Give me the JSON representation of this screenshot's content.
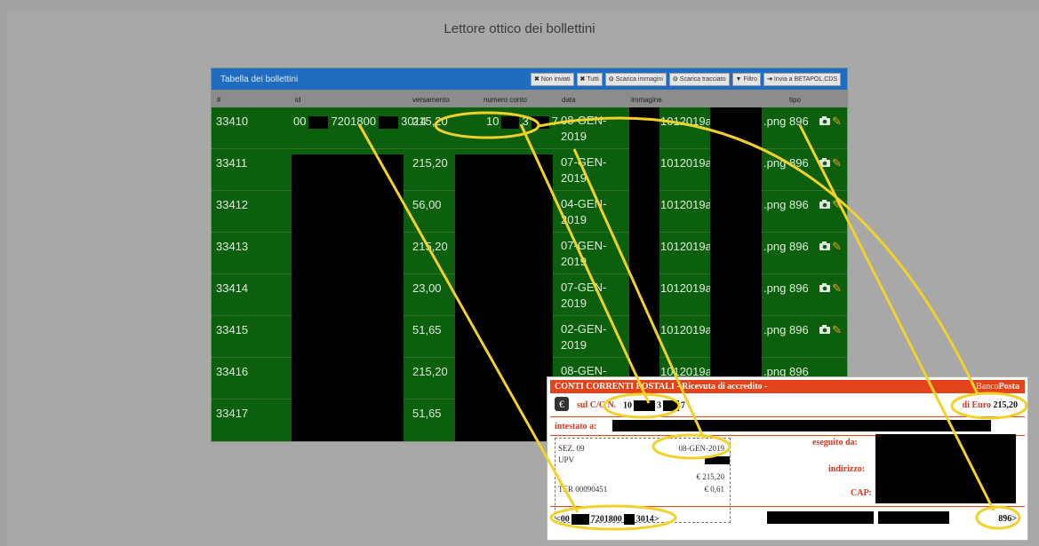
{
  "page_title": "Lettore ottico dei bollettini",
  "panel": {
    "title": "Tabella dei bollettini",
    "toolbar": [
      {
        "glyph": "✖",
        "label": "Non inviati",
        "icon": "x-icon"
      },
      {
        "glyph": "✖",
        "label": "Tutti",
        "icon": "x-icon"
      },
      {
        "glyph": "⊙",
        "label": "Scarica immagini",
        "icon": "download-icon"
      },
      {
        "glyph": "⊙",
        "label": "Scarica tracciato",
        "icon": "download-icon"
      },
      {
        "glyph": "▼",
        "label": "Filtro",
        "icon": "filter-icon"
      },
      {
        "glyph": "⇥",
        "label": "Invia a BETAPOL.CDS",
        "icon": "send-icon"
      }
    ]
  },
  "columns": {
    "num": "#",
    "id": "id",
    "versamento": "versamento",
    "numero_conto": "numero conto",
    "data": "data",
    "immagine": "immagine",
    "tipo": "tipo"
  },
  "first_row": {
    "id_a": "00",
    "id_b": "7201800",
    "id_c": "3014",
    "conto_a": "10",
    "conto_b": "3",
    "conto_c": "7"
  },
  "rows": [
    {
      "num": "33410",
      "versamento": "215,20",
      "data_1": "08-GEN-",
      "data_2": "2019",
      "img": "1012019a/",
      "ext": ".png",
      "tipo": "896"
    },
    {
      "num": "33411",
      "versamento": "215,20",
      "data_1": "07-GEN-",
      "data_2": "2019",
      "img": "1012019a/",
      "ext": ".png",
      "tipo": "896"
    },
    {
      "num": "33412",
      "versamento": "56,00",
      "data_1": "04-GEN-",
      "data_2": "2019",
      "img": "1012019a/",
      "ext": ".png",
      "tipo": "896"
    },
    {
      "num": "33413",
      "versamento": "215,20",
      "data_1": "07-GEN-",
      "data_2": "2019",
      "img": "1012019a/",
      "ext": ".png",
      "tipo": "896"
    },
    {
      "num": "33414",
      "versamento": "23,00",
      "data_1": "07-GEN-",
      "data_2": "2019",
      "img": "1012019a/",
      "ext": ".png",
      "tipo": "896"
    },
    {
      "num": "33415",
      "versamento": "51,65",
      "data_1": "02-GEN-",
      "data_2": "2019",
      "img": "1012019a/",
      "ext": ".png",
      "tipo": "896"
    },
    {
      "num": "33416",
      "versamento": "215,20",
      "data_1": "08-GEN-",
      "data_2": "",
      "img": "1012019a/",
      "ext": ".png",
      "tipo": "896"
    },
    {
      "num": "33417",
      "versamento": "51,65",
      "data_1": "",
      "data_2": "",
      "img": "",
      "ext": "",
      "tipo": ""
    }
  ],
  "receipt": {
    "header_left": "CONTI CORRENTI POSTALI - Ricevuta di accredito -",
    "header_brand_a": "Banco",
    "header_brand_b": "Posta",
    "sul_cc_label": "sul C/C N.",
    "conto_a": "10",
    "conto_b": "3",
    "conto_c": "7",
    "di_euro_label": "di Euro",
    "amount": "215,20",
    "intestato_label": "intestato a:",
    "sez": "SEZ. 09",
    "date": "08-GEN-2019",
    "upv": "UPV",
    "amount_line": "€ 215,20",
    "ter": "TER 00090451",
    "fee": "€ 0,61",
    "eseguito_label": "eseguito da:",
    "indirizzo_label": "indirizzo:",
    "cap_label": "CAP:",
    "code_a": "<00",
    "code_b": "7201800",
    "code_c": "3014>",
    "tipo_code": "896>"
  },
  "colors": {
    "panel_header": "#1f6cc1",
    "table_bg": "#0c5f0c",
    "highlight": "#f2d12a",
    "receipt_red": "#e44319"
  }
}
